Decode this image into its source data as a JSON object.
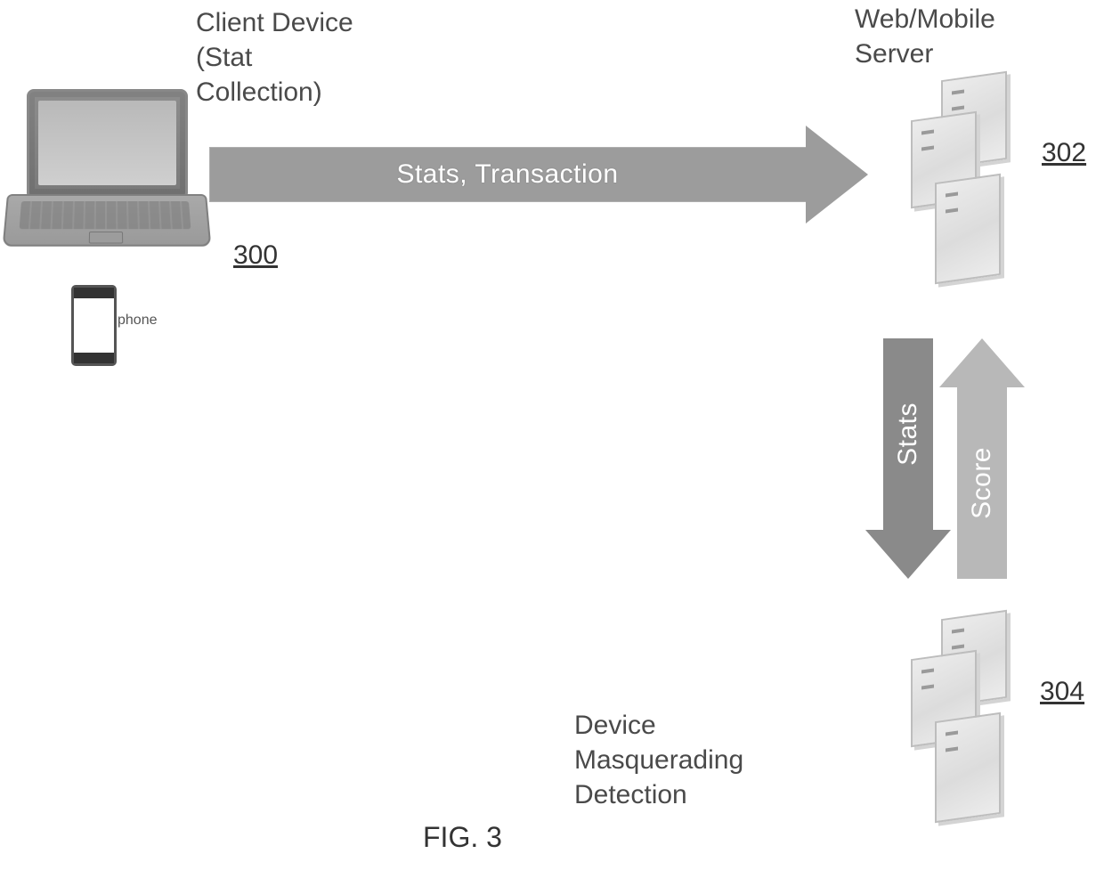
{
  "labels": {
    "client": "Client Device\n(Stat\nCollection)",
    "web_server": "Web/Mobile\nServer",
    "detection": "Device\nMasquerading\nDetection",
    "phone": "phone",
    "figure": "FIG. 3"
  },
  "refs": {
    "r300": "300",
    "r302": "302",
    "r304": "304"
  },
  "arrows": {
    "stats_tx": "Stats, Transaction",
    "stats": "Stats",
    "score": "Score"
  }
}
